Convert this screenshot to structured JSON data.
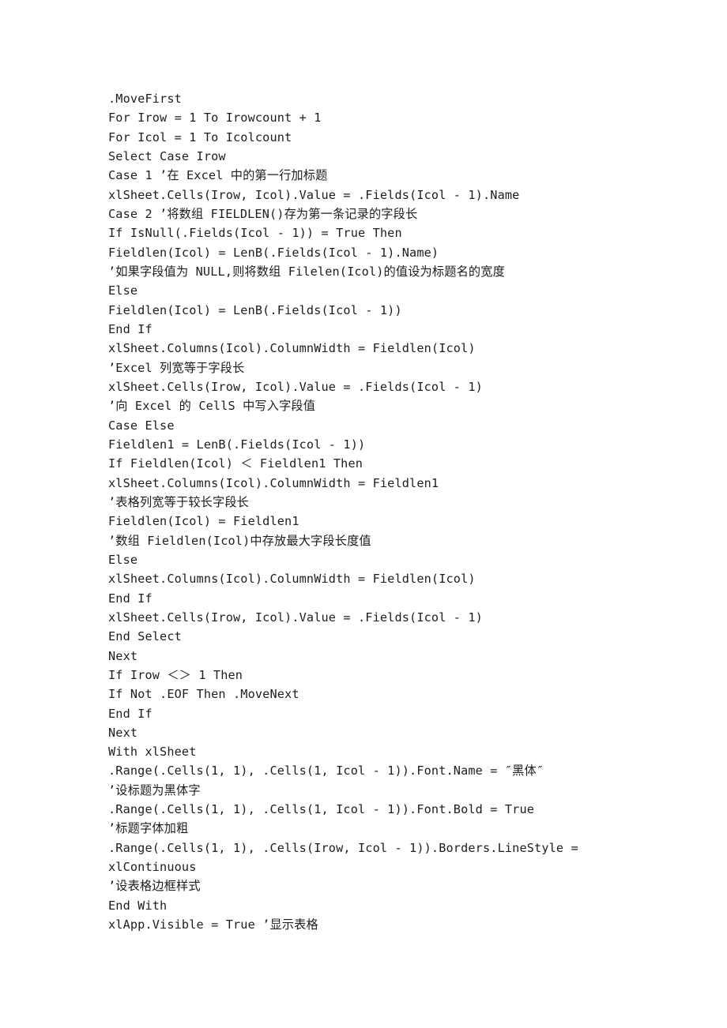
{
  "document": {
    "type": "code-listing",
    "language": "VBA",
    "background_color": "#ffffff",
    "text_color": "#1d1d1d"
  },
  "code": {
    "lines": [
      ".MoveFirst",
      "For Irow = 1 To Irowcount + 1",
      "For Icol = 1 To Icolcount",
      "Select Case Irow",
      "Case 1 ’在 Excel 中的第一行加标题",
      "xlSheet.Cells(Irow, Icol).Value = .Fields(Icol - 1).Name",
      "Case 2 ’将数组 FIELDLEN()存为第一条记录的字段长",
      "If IsNull(.Fields(Icol - 1)) = True Then",
      "Fieldlen(Icol) = LenB(.Fields(Icol - 1).Name)",
      "’如果字段值为 NULL,则将数组 Filelen(Icol)的值设为标题名的宽度",
      "Else",
      "Fieldlen(Icol) = LenB(.Fields(Icol - 1))",
      "End If",
      "xlSheet.Columns(Icol).ColumnWidth = Fieldlen(Icol)",
      "’Excel 列宽等于字段长",
      "xlSheet.Cells(Irow, Icol).Value = .Fields(Icol - 1)",
      "’向 Excel 的 CellS 中写入字段值",
      "Case Else",
      "Fieldlen1 = LenB(.Fields(Icol - 1))",
      "If Fieldlen(Icol) ＜ Fieldlen1 Then",
      "xlSheet.Columns(Icol).ColumnWidth = Fieldlen1",
      "’表格列宽等于较长字段长",
      "Fieldlen(Icol) = Fieldlen1",
      "’数组 Fieldlen(Icol)中存放最大字段长度值",
      "Else",
      "xlSheet.Columns(Icol).ColumnWidth = Fieldlen(Icol)",
      "End If",
      "xlSheet.Cells(Irow, Icol).Value = .Fields(Icol - 1)",
      "End Select",
      "Next",
      "If Irow ＜＞ 1 Then",
      "If Not .EOF Then .MoveNext",
      "End If",
      "Next",
      "With xlSheet",
      ".Range(.Cells(1, 1), .Cells(1, Icol - 1)).Font.Name = ″黑体″",
      "’设标题为黑体字",
      ".Range(.Cells(1, 1), .Cells(1, Icol - 1)).Font.Bold = True",
      "’标题字体加粗",
      ".Range(.Cells(1, 1), .Cells(Irow, Icol - 1)).Borders.LineStyle =",
      "xlContinuous",
      "’设表格边框样式",
      "End With",
      "xlApp.Visible = True ’显示表格"
    ]
  }
}
